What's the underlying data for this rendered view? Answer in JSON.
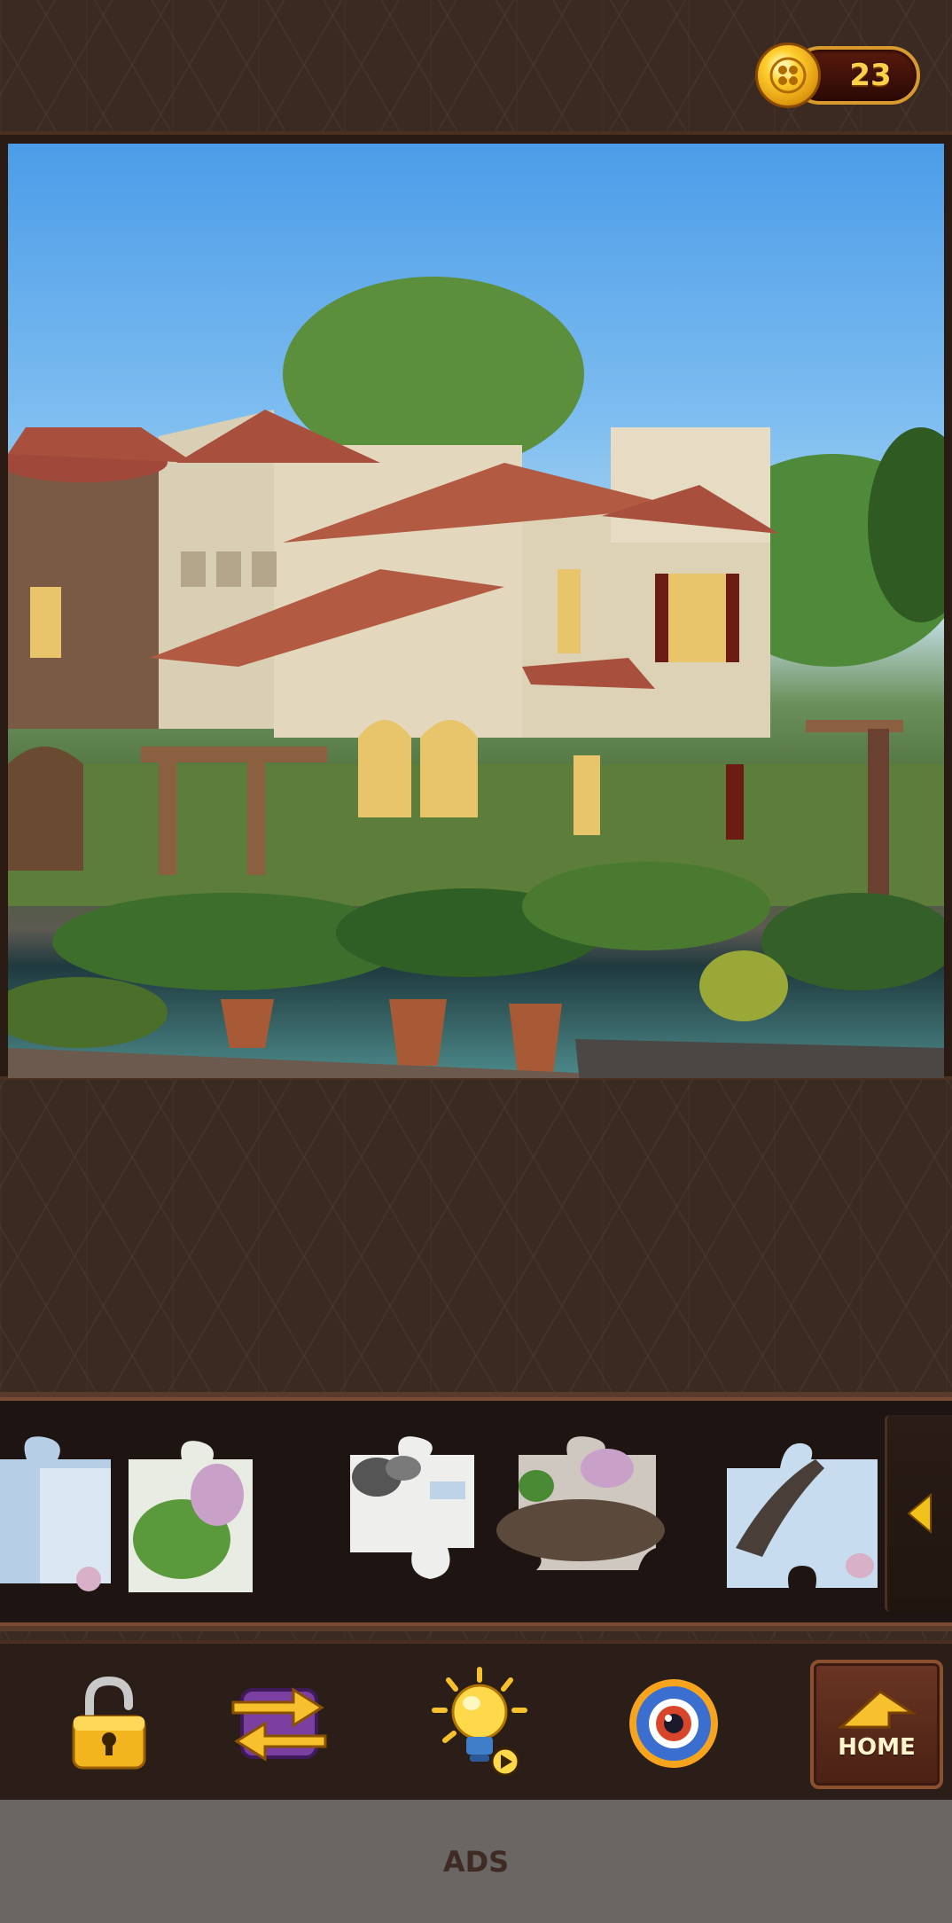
{
  "hud": {
    "coin_count": "23",
    "coin_icon": "gold-coin-icon"
  },
  "board": {
    "image_subject": "villa-with-garden-and-pool",
    "frame_color": "#2a1a14"
  },
  "tray": {
    "pieces": [
      {
        "name": "piece-1"
      },
      {
        "name": "piece-2"
      },
      {
        "name": "piece-3"
      },
      {
        "name": "piece-4"
      },
      {
        "name": "piece-5"
      }
    ],
    "scroll_icon": "triangle-left-icon"
  },
  "toolbar": {
    "tools": [
      {
        "name": "unlock-tool",
        "icon": "padlock-open-icon"
      },
      {
        "name": "swap-tool",
        "icon": "swap-arrows-icon"
      },
      {
        "name": "hint-tool",
        "icon": "lightbulb-icon"
      },
      {
        "name": "preview-tool",
        "icon": "eye-icon"
      }
    ],
    "home_label": "HOME",
    "home_icon": "home-arrow-icon"
  },
  "ads": {
    "label": "ADS"
  },
  "colors": {
    "background": "#3a2a22",
    "accent_gold": "#ffd04a",
    "home_button": "#6a3522"
  }
}
